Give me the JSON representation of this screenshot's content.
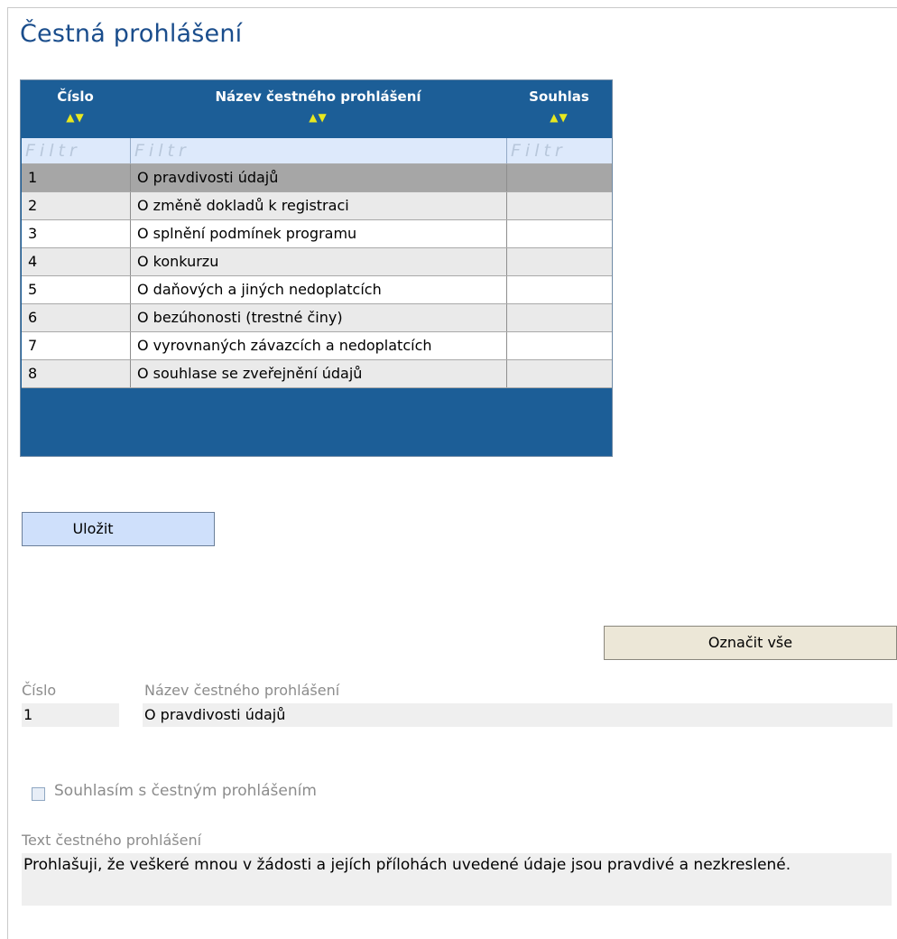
{
  "page": {
    "title": "Čestná prohlášení"
  },
  "grid": {
    "columns": [
      {
        "label": "Číslo"
      },
      {
        "label": "Název čestného prohlášení"
      },
      {
        "label": "Souhlas"
      }
    ],
    "filter_placeholder": "Filtr",
    "rows": [
      {
        "num": "1",
        "name": "O pravdivosti údajů",
        "consent": ""
      },
      {
        "num": "2",
        "name": "O změně dokladů k registraci",
        "consent": ""
      },
      {
        "num": "3",
        "name": "O splnění podmínek programu",
        "consent": ""
      },
      {
        "num": "4",
        "name": "O konkurzu",
        "consent": ""
      },
      {
        "num": "5",
        "name": "O daňových a jiných nedoplatcích",
        "consent": ""
      },
      {
        "num": "6",
        "name": "O bezúhonosti (trestné činy)",
        "consent": ""
      },
      {
        "num": "7",
        "name": "O vyrovnaných závazcích a nedoplatcích",
        "consent": ""
      },
      {
        "num": "8",
        "name": "O souhlase se zveřejnění údajů",
        "consent": ""
      }
    ],
    "selected_row": 1
  },
  "buttons": {
    "save": "Uložit",
    "select_all": "Označit vše"
  },
  "detail": {
    "num_label": "Číslo",
    "num_value": "1",
    "name_label": "Název čestného prohlášení",
    "name_value": "O pravdivosti údajů",
    "consent_label": "Souhlasím s čestným prohlášením",
    "consent_checked": false,
    "text_label": "Text čestného prohlášení",
    "text_value": "Prohlašuji, že veškeré mnou v žádosti a jejích přílohách uvedené údaje jsou pravdivé a nezkreslené."
  },
  "colors": {
    "header_bg": "#1c5e97",
    "sort_arrows": "#e8e820",
    "selected_row": "#a6a6a6",
    "title": "#1a4d8c"
  }
}
